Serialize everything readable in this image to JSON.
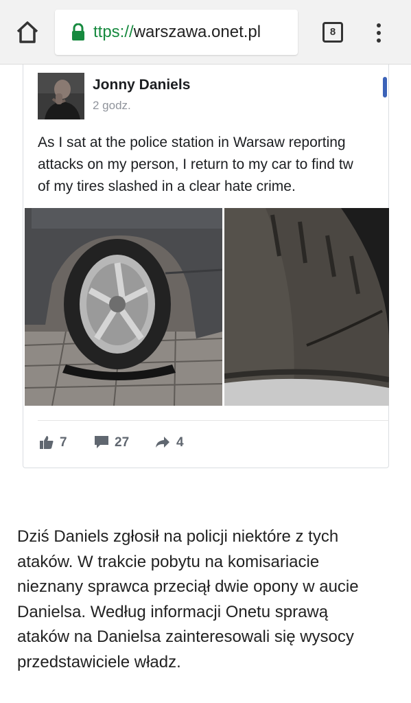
{
  "browser": {
    "url_scheme": "ttps://",
    "url_host": "warszawa.onet.pl",
    "tab_count": "8",
    "icons": [
      "home-icon",
      "lock-icon",
      "tabs-icon",
      "more-menu-icon"
    ],
    "accent_color": "#178a3f"
  },
  "post": {
    "author": "Jonny Daniels",
    "time": "2 godz.",
    "text": "As I sat at the police station in Warsaw reporting\nattacks on my person, I return to my car to find tw\nof my tires slashed in a clear hate crime.",
    "reactions": {
      "likes": "7",
      "comments": "27",
      "shares": "4"
    },
    "icons": [
      "thumbs-up-icon",
      "comment-icon",
      "share-icon"
    ]
  },
  "article": {
    "paragraph": "Dziś Daniels zgłosił na policji niektóre z tych\nataków. W trakcie pobytu na komisariacie\nnieznany sprawca przeciął dwie opony w aucie\nDanielsa. Według informacji Onetu sprawą\nataków na Danielsa zainteresowali się wysocy\nprzedstawiciele władz."
  }
}
